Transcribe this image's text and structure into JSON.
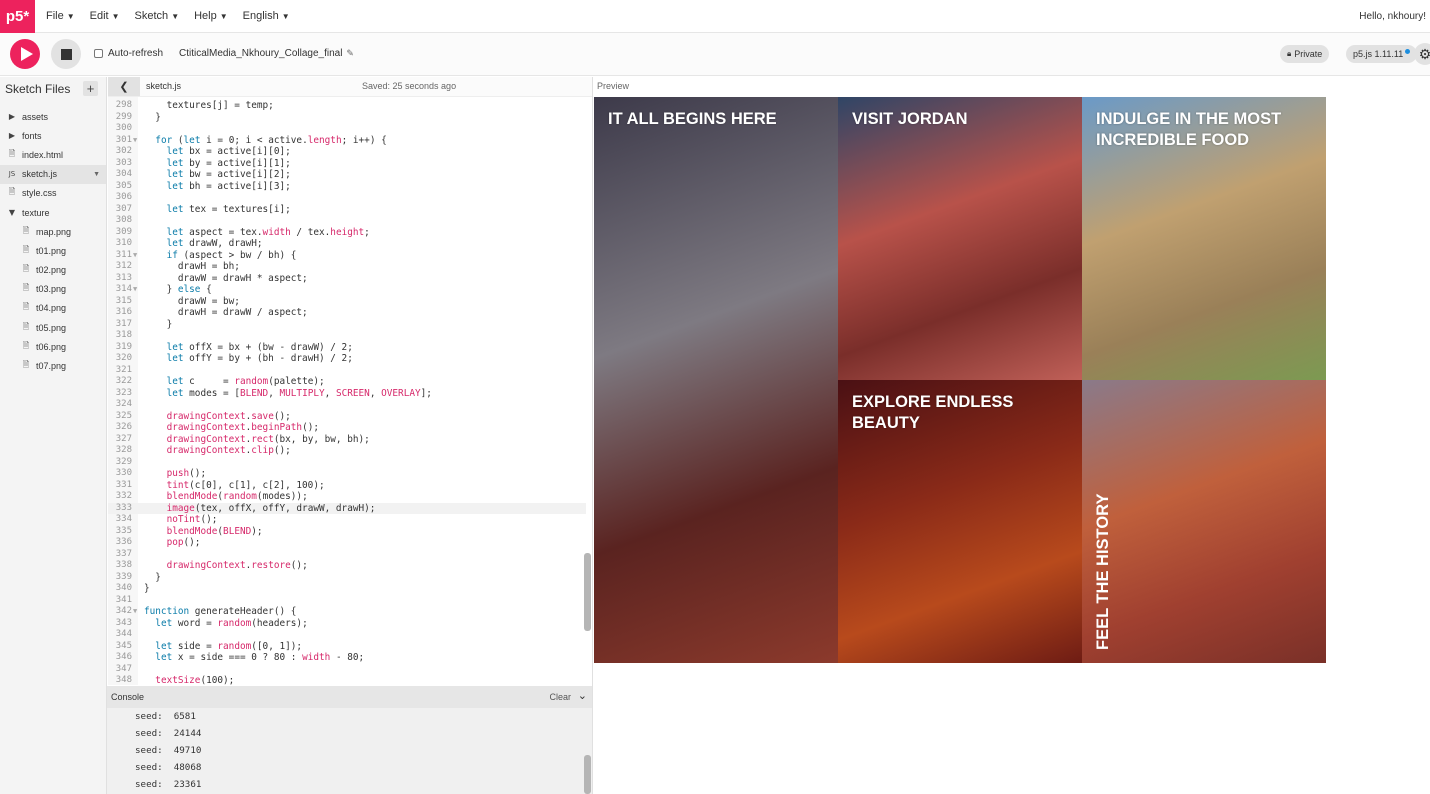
{
  "app": {
    "logo_text": "p5*",
    "menu": [
      "File",
      "Edit",
      "Sketch",
      "Help",
      "English"
    ],
    "greeting": "Hello, nkhoury!"
  },
  "toolbar": {
    "auto_refresh_label": "Auto-refresh",
    "auto_refresh_checked": false,
    "project_name": "CtiticalMedia_Nkhoury_Collage_final",
    "private_label": "Private",
    "version_label": "p5.js 1.11.11"
  },
  "sidebar": {
    "title": "Sketch Files",
    "files": [
      {
        "name": "assets",
        "type": "folder-closed",
        "level": 0
      },
      {
        "name": "fonts",
        "type": "folder-closed",
        "level": 0
      },
      {
        "name": "index.html",
        "type": "file",
        "level": 0
      },
      {
        "name": "sketch.js",
        "type": "js",
        "level": 0,
        "active": true
      },
      {
        "name": "style.css",
        "type": "file",
        "level": 0
      },
      {
        "name": "texture",
        "type": "folder-open",
        "level": 0
      },
      {
        "name": "map.png",
        "type": "file",
        "level": 1
      },
      {
        "name": "t01.png",
        "type": "file",
        "level": 1
      },
      {
        "name": "t02.png",
        "type": "file",
        "level": 1
      },
      {
        "name": "t03.png",
        "type": "file",
        "level": 1
      },
      {
        "name": "t04.png",
        "type": "file",
        "level": 1
      },
      {
        "name": "t05.png",
        "type": "file",
        "level": 1
      },
      {
        "name": "t06.png",
        "type": "file",
        "level": 1
      },
      {
        "name": "t07.png",
        "type": "file",
        "level": 1
      }
    ]
  },
  "editor": {
    "tab_name": "sketch.js",
    "saved_status": "Saved: 25 seconds ago",
    "highlighted_line": 333,
    "lines": [
      {
        "n": 298,
        "t": "    textures[j] = temp;"
      },
      {
        "n": 299,
        "t": "  }"
      },
      {
        "n": 300,
        "t": ""
      },
      {
        "n": 301,
        "t": "  for (let i = 0; i < active.length; i++) {",
        "fold": true
      },
      {
        "n": 302,
        "t": "    let bx = active[i][0];"
      },
      {
        "n": 303,
        "t": "    let by = active[i][1];"
      },
      {
        "n": 304,
        "t": "    let bw = active[i][2];"
      },
      {
        "n": 305,
        "t": "    let bh = active[i][3];"
      },
      {
        "n": 306,
        "t": ""
      },
      {
        "n": 307,
        "t": "    let tex = textures[i];"
      },
      {
        "n": 308,
        "t": ""
      },
      {
        "n": 309,
        "t": "    let aspect = tex.width / tex.height;"
      },
      {
        "n": 310,
        "t": "    let drawW, drawH;"
      },
      {
        "n": 311,
        "t": "    if (aspect > bw / bh) {",
        "fold": true
      },
      {
        "n": 312,
        "t": "      drawH = bh;"
      },
      {
        "n": 313,
        "t": "      drawW = drawH * aspect;"
      },
      {
        "n": 314,
        "t": "    } else {",
        "fold": true
      },
      {
        "n": 315,
        "t": "      drawW = bw;"
      },
      {
        "n": 316,
        "t": "      drawH = drawW / aspect;"
      },
      {
        "n": 317,
        "t": "    }"
      },
      {
        "n": 318,
        "t": ""
      },
      {
        "n": 319,
        "t": "    let offX = bx + (bw - drawW) / 2;"
      },
      {
        "n": 320,
        "t": "    let offY = by + (bh - drawH) / 2;"
      },
      {
        "n": 321,
        "t": ""
      },
      {
        "n": 322,
        "t": "    let c     = random(palette);"
      },
      {
        "n": 323,
        "t": "    let modes = [BLEND, MULTIPLY, SCREEN, OVERLAY];"
      },
      {
        "n": 324,
        "t": ""
      },
      {
        "n": 325,
        "t": "    drawingContext.save();"
      },
      {
        "n": 326,
        "t": "    drawingContext.beginPath();"
      },
      {
        "n": 327,
        "t": "    drawingContext.rect(bx, by, bw, bh);"
      },
      {
        "n": 328,
        "t": "    drawingContext.clip();"
      },
      {
        "n": 329,
        "t": ""
      },
      {
        "n": 330,
        "t": "    push();"
      },
      {
        "n": 331,
        "t": "    tint(c[0], c[1], c[2], 100);"
      },
      {
        "n": 332,
        "t": "    blendMode(random(modes));"
      },
      {
        "n": 333,
        "t": "    image(tex, offX, offY, drawW, drawH);"
      },
      {
        "n": 334,
        "t": "    noTint();"
      },
      {
        "n": 335,
        "t": "    blendMode(BLEND);"
      },
      {
        "n": 336,
        "t": "    pop();"
      },
      {
        "n": 337,
        "t": ""
      },
      {
        "n": 338,
        "t": "    drawingContext.restore();"
      },
      {
        "n": 339,
        "t": "  }"
      },
      {
        "n": 340,
        "t": "}"
      },
      {
        "n": 341,
        "t": ""
      },
      {
        "n": 342,
        "t": "function generateHeader() {",
        "fold": true
      },
      {
        "n": 343,
        "t": "  let word = random(headers);"
      },
      {
        "n": 344,
        "t": ""
      },
      {
        "n": 345,
        "t": "  let side = random([0, 1]);"
      },
      {
        "n": 346,
        "t": "  let x = side === 0 ? 80 : width - 80;"
      },
      {
        "n": 347,
        "t": ""
      },
      {
        "n": 348,
        "t": "  textSize(100);"
      }
    ]
  },
  "console": {
    "title": "Console",
    "clear_label": "Clear",
    "lines": [
      "seed:  6581",
      "seed:  24144",
      "seed:  49710",
      "seed:  48068",
      "seed:  23361"
    ]
  },
  "preview": {
    "label": "Preview",
    "panels": [
      {
        "heading": "IT ALL BEGINS HERE",
        "colors": [
          "#3d3a4a",
          "#7e7a82",
          "#5a2320",
          "#8c3a2c"
        ]
      },
      {
        "heading": "VISIT JORDAN",
        "colors": [
          "#2f4566",
          "#b8524a",
          "#7a2e2a",
          "#c06058"
        ]
      },
      {
        "heading": "INDULGE IN THE MOST INCREDIBLE FOOD",
        "colors": [
          "#6a9ac8",
          "#c0a070",
          "#9a8058",
          "#7c9a52"
        ]
      },
      {
        "heading": "EXPLORE ENDLESS BEAUTY",
        "colors": [
          "#4a1014",
          "#8a2a18",
          "#b84a1c",
          "#6e1c14"
        ]
      },
      {
        "heading": "FEEL THE HISTORY",
        "colors": [
          "#8a7a8a",
          "#c0603c",
          "#a04030",
          "#7a3028"
        ]
      }
    ]
  }
}
